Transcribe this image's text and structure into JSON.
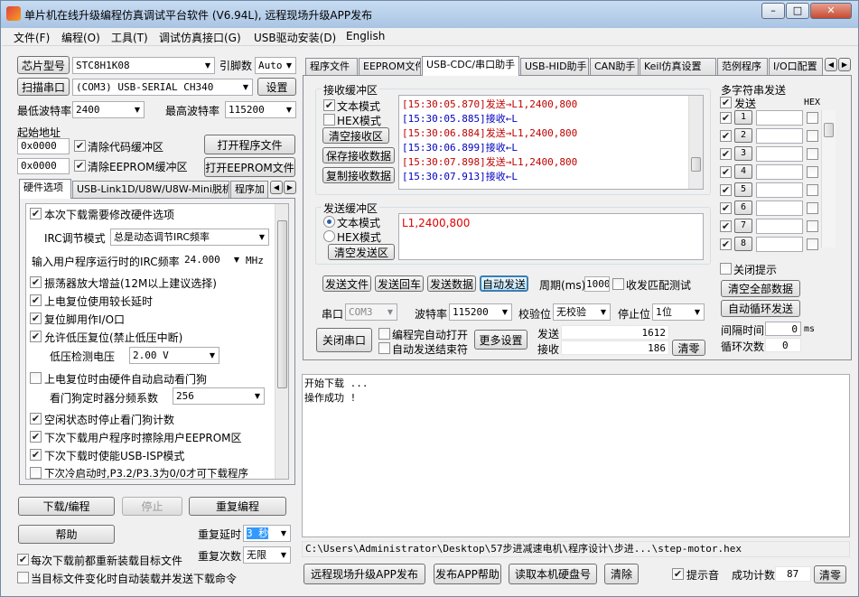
{
  "window": {
    "title": "单片机在线升级编程仿真调试平台软件 (V6.94L), 远程现场升级APP发布",
    "min": "0",
    "max": "1",
    "close": "r"
  },
  "menu": [
    "文件(F)",
    "编程(O)",
    "工具(T)",
    "调试仿真接口(G)",
    "USB驱动安装(D)",
    "English"
  ],
  "left": {
    "chip_btn": "芯片型号",
    "chip_value": "STC8H1K08",
    "pins_label": "引脚数",
    "pins_value": "Auto",
    "scan_btn": "扫描串口",
    "port_value": "(COM3) USB-SERIAL CH340",
    "settings_btn": "设置",
    "min_baud_label": "最低波特率",
    "min_baud_value": "2400",
    "max_baud_label": "最高波特率",
    "max_baud_value": "115200",
    "start_addr_label": "起始地址",
    "code_addr": "0x0000",
    "clear_code_label": "清除代码缓冲区",
    "open_prog_btn": "打开程序文件",
    "eeprom_addr": "0x0000",
    "clear_eeprom_label": "清除EEPROM缓冲区",
    "open_eeprom_btn": "打开EEPROM文件",
    "tabs": [
      "硬件选项",
      "USB-Link1D/U8W/U8W-Mini脱机",
      "程序加"
    ],
    "hw": {
      "opt_modify": "本次下载需要修改硬件选项",
      "irc_mode_label": "IRC调节模式",
      "irc_mode_value": "总是动态调节IRC频率",
      "irc_freq_label": "输入用户程序运行时的IRC频率",
      "irc_freq_value": "24.000",
      "irc_freq_unit": "MHz",
      "opt_amp": "振荡器放大增益(12M以上建议选择)",
      "opt_long_delay": "上电复位使用较长延时",
      "opt_reset_io": "复位脚用作I/O口",
      "opt_lvd": "允许低压复位(禁止低压中断)",
      "lvd_label": "低压检测电压",
      "lvd_value": "2.00 V",
      "opt_wdt": "上电复位时由硬件自动启动看门狗",
      "wdt_label": "看门狗定时器分频系数",
      "wdt_value": "256",
      "opt_idle_wdt": "空闲状态时停止看门狗计数",
      "opt_erase_eeprom": "下次下载用户程序时擦除用户EEPROM区",
      "opt_usb_isp": "下次下载时使能USB-ISP模式",
      "opt_cold": "下次冷启动时,P3.2/P3.3为0/0才可下载程序"
    },
    "download_btn": "下载/编程",
    "stop_btn": "停止",
    "reprogram_btn": "重复编程",
    "help_btn": "帮助",
    "repeat_delay_label": "重复延时",
    "repeat_delay_value": "3 秒",
    "repeat_count_label": "重复次数",
    "repeat_count_value": "无限",
    "reload_label": "每次下载前都重新装载目标文件",
    "auto_load_label": "当目标文件变化时自动装载并发送下载命令"
  },
  "right": {
    "tabs": [
      "程序文件",
      "EEPROM文件",
      "USB-CDC/串口助手",
      "USB-HID助手",
      "CAN助手",
      "Keil仿真设置",
      "范例程序",
      "I/O口配置"
    ],
    "recv_title": "接收缓冲区",
    "text_mode": "文本模式",
    "hex_mode": "HEX模式",
    "clear_recv_btn": "清空接收区",
    "save_recv_btn": "保存接收数据",
    "copy_recv_btn": "复制接收数据",
    "recv_lines": [
      {
        "text": "[15:30:05.870]发送→L1,2400,800",
        "color": "#c00000"
      },
      {
        "text": "[15:30:05.885]接收←L",
        "color": "#0000c0"
      },
      {
        "text": "[15:30:06.884]发送→L1,2400,800",
        "color": "#c00000"
      },
      {
        "text": "[15:30:06.899]接收←L",
        "color": "#0000c0"
      },
      {
        "text": "[15:30:07.898]发送→L1,2400,800",
        "color": "#c00000"
      },
      {
        "text": "[15:30:07.913]接收←L",
        "color": "#0000c0"
      }
    ],
    "send_title": "发送缓冲区",
    "send_text": "L1,2400,800",
    "clear_send_btn": "清空发送区",
    "send_file_btn": "发送文件",
    "send_cr_btn": "发送回车",
    "send_data_btn": "发送数据",
    "auto_send_btn": "自动发送",
    "period_label": "周期(ms)",
    "period_value": "1000",
    "match_label": "收发匹配测试",
    "port_label": "串口",
    "port_value": "COM3",
    "baud_label": "波特率",
    "baud_value": "115200",
    "parity_label": "校验位",
    "parity_value": "无校验",
    "stop_label": "停止位",
    "stop_value": "1位",
    "close_port_btn": "关闭串口",
    "auto_open_label": "编程完自动打开",
    "auto_send_end_label": "自动发送结束符",
    "more_btn": "更多设置",
    "tx_label": "发送",
    "tx_value": "1612",
    "rx_label": "接收",
    "rx_value": "186",
    "clear_count_btn": "清零",
    "multi": {
      "title": "多字符串发送",
      "send_col": "发送",
      "hex_col": "HEX",
      "rows": [
        "1",
        "2",
        "3",
        "4",
        "5",
        "6",
        "7",
        "8"
      ],
      "close_hint": "关闭提示",
      "clear_all_btn": "清空全部数据",
      "auto_loop_btn": "自动循环发送",
      "interval_label": "间隔时间",
      "interval_value": "0",
      "interval_unit": "ms",
      "loop_count_label": "循环次数",
      "loop_count_value": "0"
    },
    "log_lines": [
      "开始下载 ...",
      "操作成功 !"
    ],
    "file_path": "C:\\Users\\Administrator\\Desktop\\57步进减速电机\\程序设计\\步进...\\step-motor.hex"
  },
  "bottom": {
    "publish_btn": "远程现场升级APP发布",
    "publish_help_btn": "发布APP帮助",
    "read_disk_btn": "读取本机硬盘号",
    "clear_btn": "清除",
    "beep_label": "提示音",
    "success_label": "成功计数",
    "success_value": "87",
    "clear_success_btn": "清零"
  }
}
